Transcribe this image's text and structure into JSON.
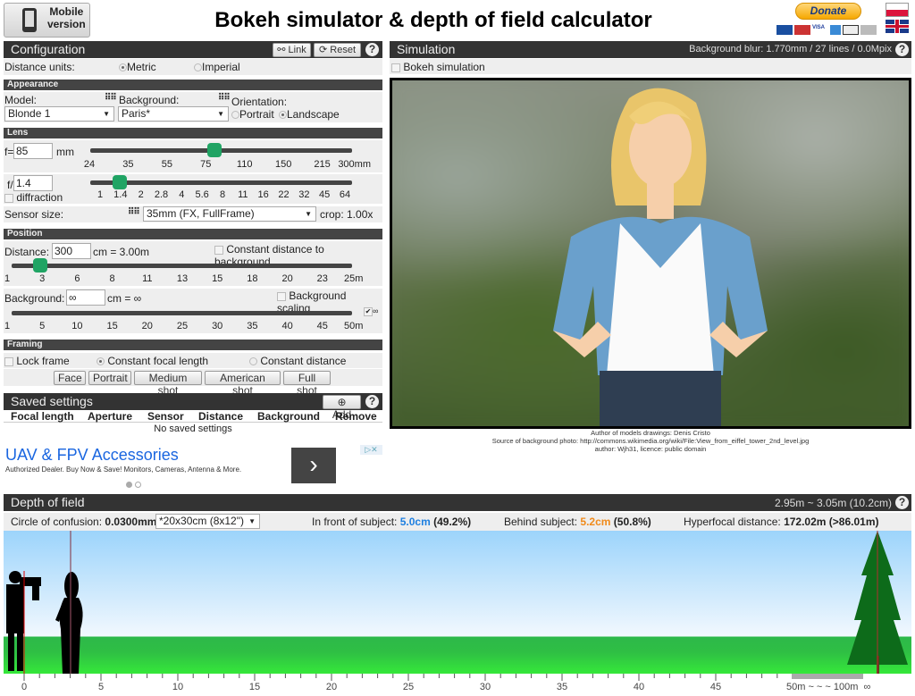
{
  "header": {
    "mobile_label_1": "Mobile",
    "mobile_label_2": "version",
    "title": "Bokeh simulator & depth of field calculator",
    "donate": "Donate",
    "payment_icons": [
      "Maestro",
      "MasterCard",
      "VISA",
      "AMEX",
      "DISCOVER",
      "BANK"
    ],
    "languages": [
      "pl-flag-icon",
      "uk-flag-icon"
    ]
  },
  "config": {
    "title": "Configuration",
    "link": "Link",
    "reset": "Reset",
    "help": "?",
    "distance_units_label": "Distance units:",
    "metric": "Metric",
    "imperial": "Imperial",
    "units_selected": "Metric"
  },
  "appearance": {
    "title": "Appearance",
    "model_label": "Model:",
    "model_value": "Blonde 1",
    "background_label": "Background:",
    "background_value": "Paris*",
    "orientation_label": "Orientation:",
    "portrait": "Portrait",
    "landscape": "Landscape",
    "orientation_selected": "Landscape"
  },
  "lens": {
    "title": "Lens",
    "f_label": "f=",
    "focal_value": "85",
    "mm": "mm",
    "focal_ticks": [
      "24",
      "35",
      "55",
      "75",
      "110",
      "150",
      "215",
      "300mm"
    ],
    "aperture_label": "f/",
    "aperture_value": "1.4",
    "diffraction": "diffraction",
    "aperture_ticks": [
      "1",
      "1.4",
      "2",
      "2.8",
      "4",
      "5.6",
      "8",
      "11",
      "16",
      "22",
      "32",
      "45",
      "64"
    ],
    "sensor_label": "Sensor size:",
    "sensor_value": "35mm (FX, FullFrame)",
    "crop": "crop: 1.00x"
  },
  "position": {
    "title": "Position",
    "distance_label": "Distance:",
    "distance_value": "300",
    "distance_text": "cm = 3.00m",
    "constant_distance": "Constant distance to background",
    "distance_ticks": [
      "1",
      "3",
      "6",
      "8",
      "11",
      "13",
      "15",
      "18",
      "20",
      "23",
      "25m"
    ],
    "background_label": "Background:",
    "background_value": "∞",
    "background_text": "cm = ∞",
    "background_scaling": "Background scaling",
    "infinity_check": "∞",
    "background_ticks": [
      "1",
      "5",
      "10",
      "15",
      "20",
      "25",
      "30",
      "35",
      "40",
      "45",
      "50m"
    ]
  },
  "framing": {
    "title": "Framing",
    "lock_frame": "Lock frame",
    "constant_focal": "Constant focal length",
    "constant_distance": "Constant distance",
    "buttons": [
      "Face",
      "Portrait",
      "Medium shot",
      "American shot",
      "Full shot"
    ]
  },
  "saved": {
    "title": "Saved settings",
    "add": "Add",
    "help": "?",
    "columns": [
      "Focal length",
      "Aperture",
      "Sensor",
      "Distance",
      "Background",
      "Remove"
    ],
    "empty": "No saved settings"
  },
  "ad": {
    "title": "UAV & FPV Accessories",
    "text": "Authorized Dealer. Buy Now & Save! Monitors, Cameras, Antenna & More.",
    "arrow": "›"
  },
  "simulation": {
    "title": "Simulation",
    "blur_info": "Background blur: 1.770mm / 27 lines / 0.0Mpix",
    "help": "?",
    "bokeh_label": "Bokeh simulation",
    "credit_1": "Author of models drawings: Denis Cristo",
    "credit_2": "Source of background photo: http://commons.wikimedia.org/wiki/File:View_from_eiffel_tower_2nd_level.jpg",
    "credit_3": "author: Wjh31, licence: public domain"
  },
  "dof": {
    "title": "Depth of field",
    "range": "2.95m ~ 3.05m (10.2cm)",
    "help": "?",
    "coc_label": "Circle of confusion:",
    "coc_value": "0.0300mm",
    "print_size": "*20x30cm (8x12\")",
    "front_label": "In front of subject:",
    "front_value": "5.0cm",
    "front_pct": "(49.2%)",
    "behind_label": "Behind subject:",
    "behind_value": "5.2cm",
    "behind_pct": "(50.8%)",
    "hyper_label": "Hyperfocal distance:",
    "hyper_value": "172.02m (>86.01m)",
    "ruler_ticks": [
      "0",
      "5",
      "10",
      "15",
      "20",
      "25",
      "30",
      "35",
      "40",
      "45"
    ],
    "ruler_end": "50m ~ ~ ~ 100m  ∞",
    "front_color": "#1e7fe0",
    "behind_color": "#f08a1a"
  }
}
